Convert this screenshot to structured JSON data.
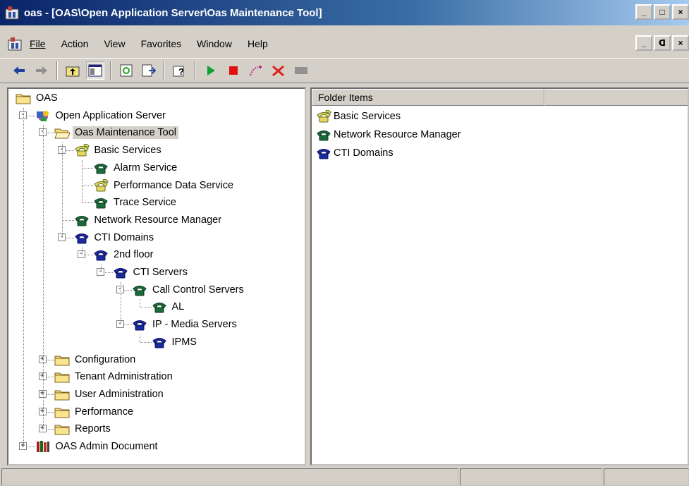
{
  "window": {
    "title": "oas - [OAS\\Open Application Server\\Oas Maintenance Tool]",
    "minimize_label": "_",
    "maximize_label": "□",
    "close_label": "×",
    "restore_label": "ᗡ"
  },
  "menubar": {
    "items": [
      {
        "label": "File",
        "accel": "F"
      },
      {
        "label": "Action",
        "accel": "A"
      },
      {
        "label": "View",
        "accel": "V"
      },
      {
        "label": "Favorites",
        "accel": "o"
      },
      {
        "label": "Window",
        "accel": "W"
      },
      {
        "label": "Help",
        "accel": "H"
      }
    ]
  },
  "toolbar": {
    "buttons": [
      "back-arrow-icon",
      "forward-arrow-icon",
      "up-folder-icon",
      "show-hide-tree-icon",
      "refresh-icon",
      "export-list-icon",
      "help-icon",
      "start-icon",
      "stop-icon",
      "connect-icon",
      "disconnect-icon",
      "pause-icon"
    ]
  },
  "tree": {
    "nodes": [
      {
        "label": "OAS",
        "icon": "folder-icon"
      },
      {
        "label": "Open Application Server",
        "icon": "server-icon"
      },
      {
        "label": "Oas Maintenance Tool",
        "icon": "open-folder-icon"
      },
      {
        "label": "Basic Services",
        "icon": "phone-yellow-icon"
      },
      {
        "label": "Alarm Service",
        "icon": "phone-green-icon"
      },
      {
        "label": "Performance Data Service",
        "icon": "phone-yellow-icon"
      },
      {
        "label": "Trace Service",
        "icon": "phone-green-icon"
      },
      {
        "label": "Network Resource Manager",
        "icon": "phone-green-icon"
      },
      {
        "label": "CTI Domains",
        "icon": "phone-blue-icon"
      },
      {
        "label": "2nd floor",
        "icon": "phone-blue-icon"
      },
      {
        "label": "CTI Servers",
        "icon": "phone-blue-icon"
      },
      {
        "label": "Call Control Servers",
        "icon": "phone-green-icon"
      },
      {
        "label": "AL",
        "icon": "phone-green-icon"
      },
      {
        "label": "IP - Media Servers",
        "icon": "phone-blue-icon"
      },
      {
        "label": "IPMS",
        "icon": "phone-blue-icon"
      },
      {
        "label": "Configuration",
        "icon": "folder-icon"
      },
      {
        "label": "Tenant Administration",
        "icon": "folder-icon"
      },
      {
        "label": "User Administration",
        "icon": "folder-icon"
      },
      {
        "label": "Performance",
        "icon": "folder-icon"
      },
      {
        "label": "Reports",
        "icon": "folder-icon"
      },
      {
        "label": "OAS Admin Document",
        "icon": "books-icon"
      }
    ]
  },
  "list": {
    "header": "Folder Items",
    "items": [
      {
        "label": "Basic Services",
        "icon": "phone-yellow-icon"
      },
      {
        "label": "Network Resource Manager",
        "icon": "phone-green-icon"
      },
      {
        "label": "CTI Domains",
        "icon": "phone-blue-icon"
      }
    ]
  },
  "colors": {
    "title_start": "#0a246a",
    "title_end": "#a6caf0",
    "chrome": "#d4d0c8"
  }
}
